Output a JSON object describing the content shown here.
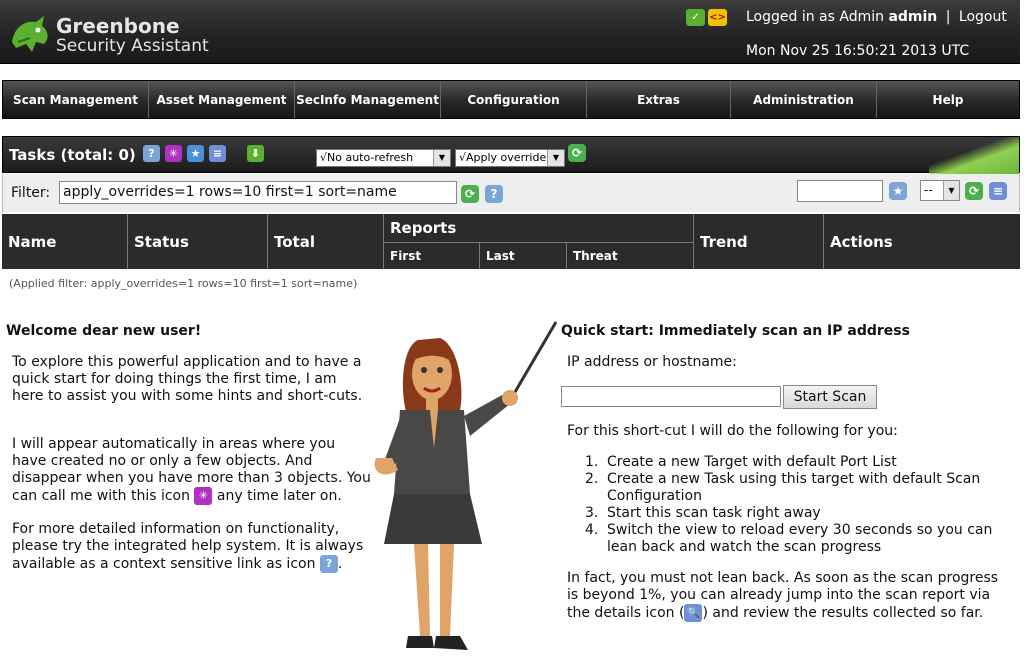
{
  "header": {
    "brand_line1": "Greenbone",
    "brand_line2": "Security Assistant",
    "logged_in_prefix": "Logged in as Admin",
    "username": "admin",
    "separator": "|",
    "logout_label": "Logout",
    "datetime": "Mon Nov 25 16:50:21 2013 UTC",
    "icons": [
      "shield-check-icon",
      "code-brackets-icon"
    ]
  },
  "nav": {
    "items": [
      {
        "label": "Scan Management"
      },
      {
        "label": "Asset Management"
      },
      {
        "label": "SecInfo Management"
      },
      {
        "label": "Configuration"
      },
      {
        "label": "Extras"
      },
      {
        "label": "Administration"
      },
      {
        "label": "Help"
      }
    ]
  },
  "tasks": {
    "title": "Tasks (total: 0)",
    "icons": [
      "help-icon",
      "wizard-icon",
      "new-task-icon",
      "list-icon",
      "download-icon"
    ],
    "auto_refresh": "√No auto-refresh",
    "overrides": "√Apply overrides"
  },
  "filter": {
    "label": "Filter:",
    "value": "apply_overrides=1 rows=10 first=1 sort=name",
    "save_value": "",
    "select_value": "--"
  },
  "table": {
    "headers": {
      "name": "Name",
      "status": "Status",
      "total": "Total",
      "reports": "Reports",
      "first": "First",
      "last": "Last",
      "threat": "Threat",
      "trend": "Trend",
      "actions": "Actions"
    },
    "applied_filter": "(Applied filter: apply_overrides=1 rows=10 first=1 sort=name)"
  },
  "welcome": {
    "title": "Welcome dear new user!",
    "p1": "To explore this powerful application and to have a quick start for doing things the first time, I am here to assist you with some hints and short-cuts.",
    "p2a": "I will appear automatically in areas where you have created no or only a few objects. And disappear when you have more than 3 objects. You can call me with this icon",
    "p2b": "any time later on.",
    "p3a": "For more detailed information on functionality, please try the integrated help system. It is always available as a context sensitive link as icon",
    "p3b": "."
  },
  "quickstart": {
    "title": "Quick start: Immediately scan an IP address",
    "ip_label": "IP address or hostname:",
    "ip_value": "",
    "button": "Start Scan",
    "intro": "For this short-cut I will do the following for you:",
    "steps": [
      "Create a new Target with default Port List",
      "Create a new Task using this target with default Scan Configuration",
      "Start this scan task right away",
      "Switch the view to reload every 30 seconds so you can lean back and watch the scan progress"
    ],
    "outro_a": "In fact, you must not lean back. As soon as the scan progress is beyond 1%, you can already jump into the scan report via the details icon (",
    "outro_b": ") and review the results collected so far."
  }
}
